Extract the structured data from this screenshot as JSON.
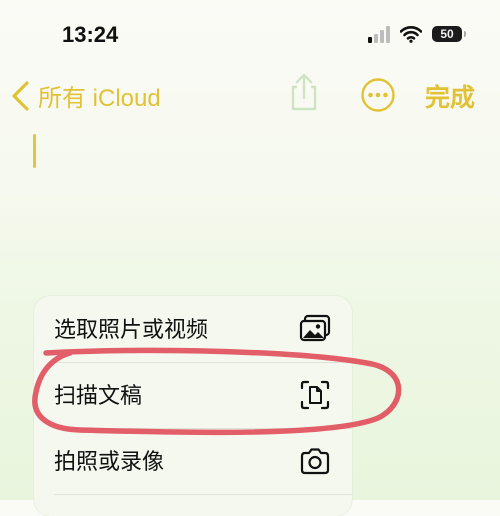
{
  "status_bar": {
    "time": "13:24",
    "battery": "50",
    "icons": [
      "signal-icon",
      "wifi-icon",
      "battery-icon"
    ]
  },
  "nav": {
    "back_label": "所有 iCloud",
    "done_label": "完成",
    "icons": [
      "chevron-left-icon",
      "share-icon",
      "more-icon"
    ]
  },
  "menu": {
    "items": [
      {
        "label": "选取照片或视频",
        "icon": "photo-library-icon"
      },
      {
        "label": "扫描文稿",
        "icon": "scan-document-icon"
      },
      {
        "label": "拍照或录像",
        "icon": "camera-icon"
      }
    ]
  },
  "colors": {
    "accent": "#e1c236",
    "annotation": "#e0505c"
  }
}
